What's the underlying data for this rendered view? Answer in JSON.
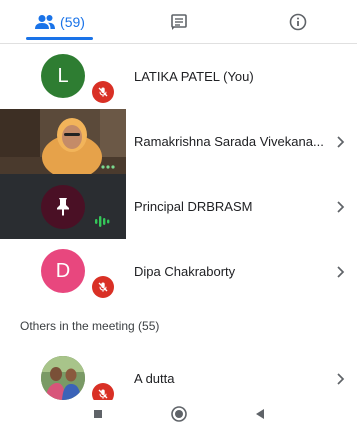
{
  "colors": {
    "accent": "#1a73e8",
    "mute_badge": "#d93025",
    "avatar_green": "#2e7d32",
    "avatar_pink": "#e8477e",
    "tile_dark": "#2a2d31",
    "speaking_green": "#34c759"
  },
  "tabs": [
    {
      "icon": "people-icon",
      "label": "(59)",
      "active": true
    },
    {
      "icon": "chat-icon",
      "label": "",
      "active": false
    },
    {
      "icon": "info-icon",
      "label": "",
      "active": false
    }
  ],
  "participants": [
    {
      "name": "LATIKA PATEL (You)",
      "avatar_letter": "L",
      "muted": true,
      "has_chevron": false
    },
    {
      "name": "Ramakrishna Sarada Vivekana...",
      "video": true,
      "has_chevron": true
    },
    {
      "name": "Principal DRBRASM",
      "pinned": true,
      "speaking": true,
      "has_chevron": true
    },
    {
      "name": "Dipa Chakraborty",
      "avatar_letter": "D",
      "muted": true,
      "has_chevron": true
    }
  ],
  "others_section": {
    "title": "Others in the meeting (55)",
    "participants": [
      {
        "name": "A dutta",
        "photo": true,
        "muted": true,
        "has_chevron": true
      }
    ]
  },
  "navbar": {
    "buttons": [
      "recents-button",
      "home-button",
      "back-button"
    ]
  }
}
